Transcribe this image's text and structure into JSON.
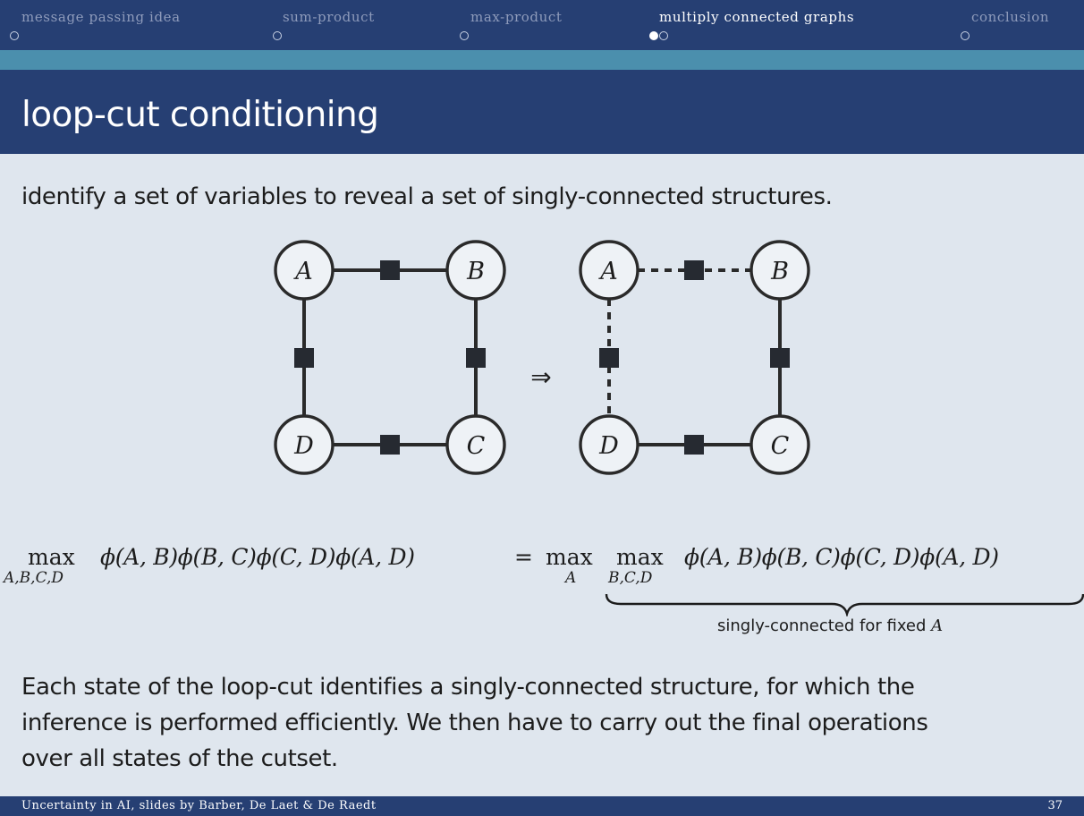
{
  "nav": {
    "sections": [
      {
        "label": "message passing idea",
        "active": false,
        "dots": 1,
        "filled": 0
      },
      {
        "label": "sum-product",
        "active": false,
        "dots": 1,
        "filled": 0
      },
      {
        "label": "max-product",
        "active": false,
        "dots": 1,
        "filled": 0
      },
      {
        "label": "multiply connected graphs",
        "active": true,
        "dots": 2,
        "filled": 1
      },
      {
        "label": "conclusion",
        "active": false,
        "dots": 1,
        "filled": 0
      }
    ]
  },
  "slide": {
    "title": "loop-cut conditioning",
    "intro": "identify a set of variables to reveal a set of singly-connected structures.",
    "arrow": "⇒",
    "graph_left": {
      "A": "A",
      "B": "B",
      "C": "C",
      "D": "D"
    },
    "graph_right": {
      "A": "A",
      "B": "B",
      "C": "C",
      "D": "D"
    },
    "equation": {
      "lhs_max": "max",
      "lhs_sub": "A,B,C,D",
      "lhs_expr": "ϕ(A, B)ϕ(B, C)ϕ(C, D)ϕ(A, D)",
      "equals": "=",
      "rhs_max1": "max",
      "rhs_sub1": "A",
      "rhs_max2": "max",
      "rhs_sub2": "B,C,D",
      "rhs_expr": "ϕ(A, B)ϕ(B, C)ϕ(C, D)ϕ(A, D)"
    },
    "brace_label": "singly-connected for fixed",
    "brace_var": "A",
    "paragraph": [
      "Each state of the loop-cut identifies a singly-connected structure, for which the",
      "inference is performed efficiently. We then have to carry out the final operations",
      "over all states of the cutset."
    ]
  },
  "footer": {
    "text": "Uncertainty in AI, slides by Barber, De Laet & De Raedt",
    "page": "37"
  },
  "colors": {
    "nav_bg": "#263f73",
    "teal_band": "#4b8fad",
    "slide_bg": "#dfe6ee",
    "text": "#1c1c1c",
    "nav_inactive": "#8e9bbb"
  }
}
